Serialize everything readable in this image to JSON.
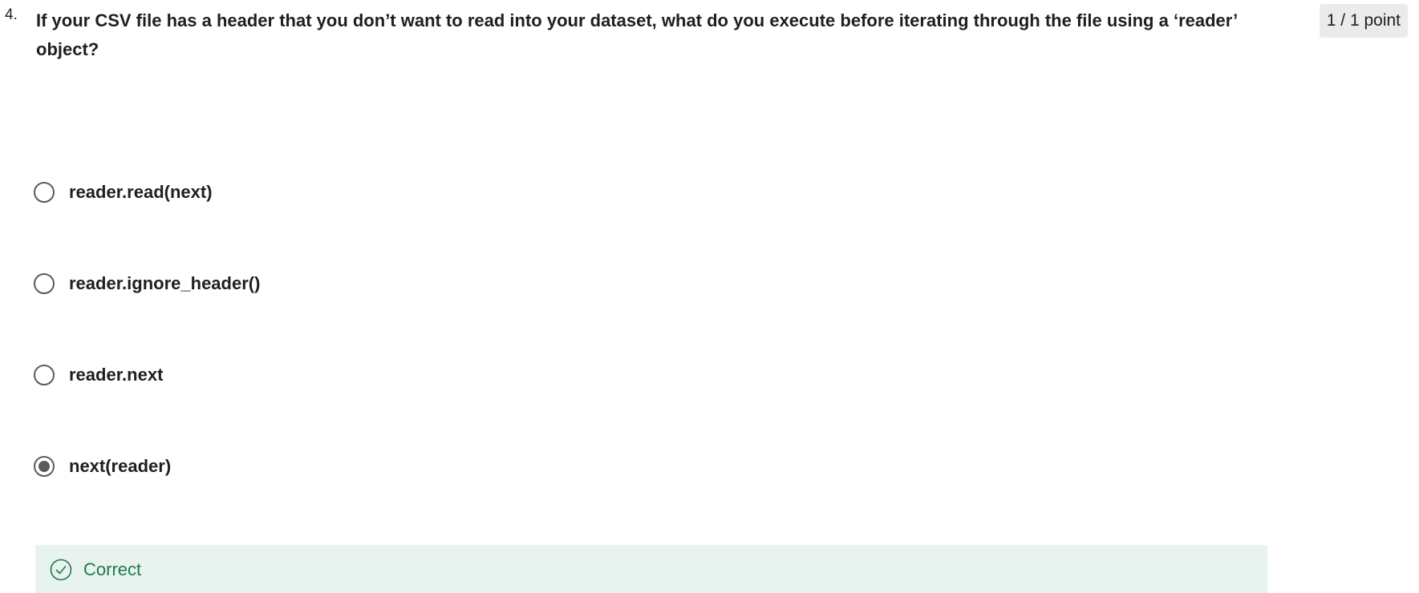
{
  "question": {
    "number": "4.",
    "text": "If your CSV file has a header that you don’t want to read into your dataset, what do you execute before iterating through the file using a ‘reader’ object?",
    "points": "1 / 1 point"
  },
  "options": [
    {
      "label": "reader.read(next)",
      "selected": false
    },
    {
      "label": "reader.ignore_header()",
      "selected": false
    },
    {
      "label": "reader.next",
      "selected": false
    },
    {
      "label": "next(reader)",
      "selected": true
    }
  ],
  "feedback": {
    "status": "Correct",
    "icon": "check-circle-icon",
    "color": "#1e7a4b",
    "background": "#e8f2ee"
  }
}
